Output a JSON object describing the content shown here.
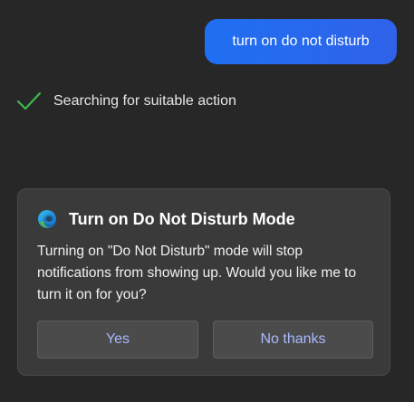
{
  "user_message": "turn on do not disturb",
  "status": {
    "icon": "checkmark-icon",
    "text": "Searching for suitable action"
  },
  "card": {
    "icon": "edge-browser-icon",
    "title": "Turn on Do Not Disturb Mode",
    "body": "Turning on \"Do Not Disturb\" mode will stop notifications from showing up. Would you like me to turn it on for you?",
    "yes_label": "Yes",
    "no_label": "No thanks"
  },
  "colors": {
    "background": "#272727",
    "user_bubble": "#1f6ff2",
    "card_background": "#3a3a3a",
    "button_background": "#4b4b4b",
    "button_text": "#a9b8ff",
    "check": "#3fb950"
  }
}
